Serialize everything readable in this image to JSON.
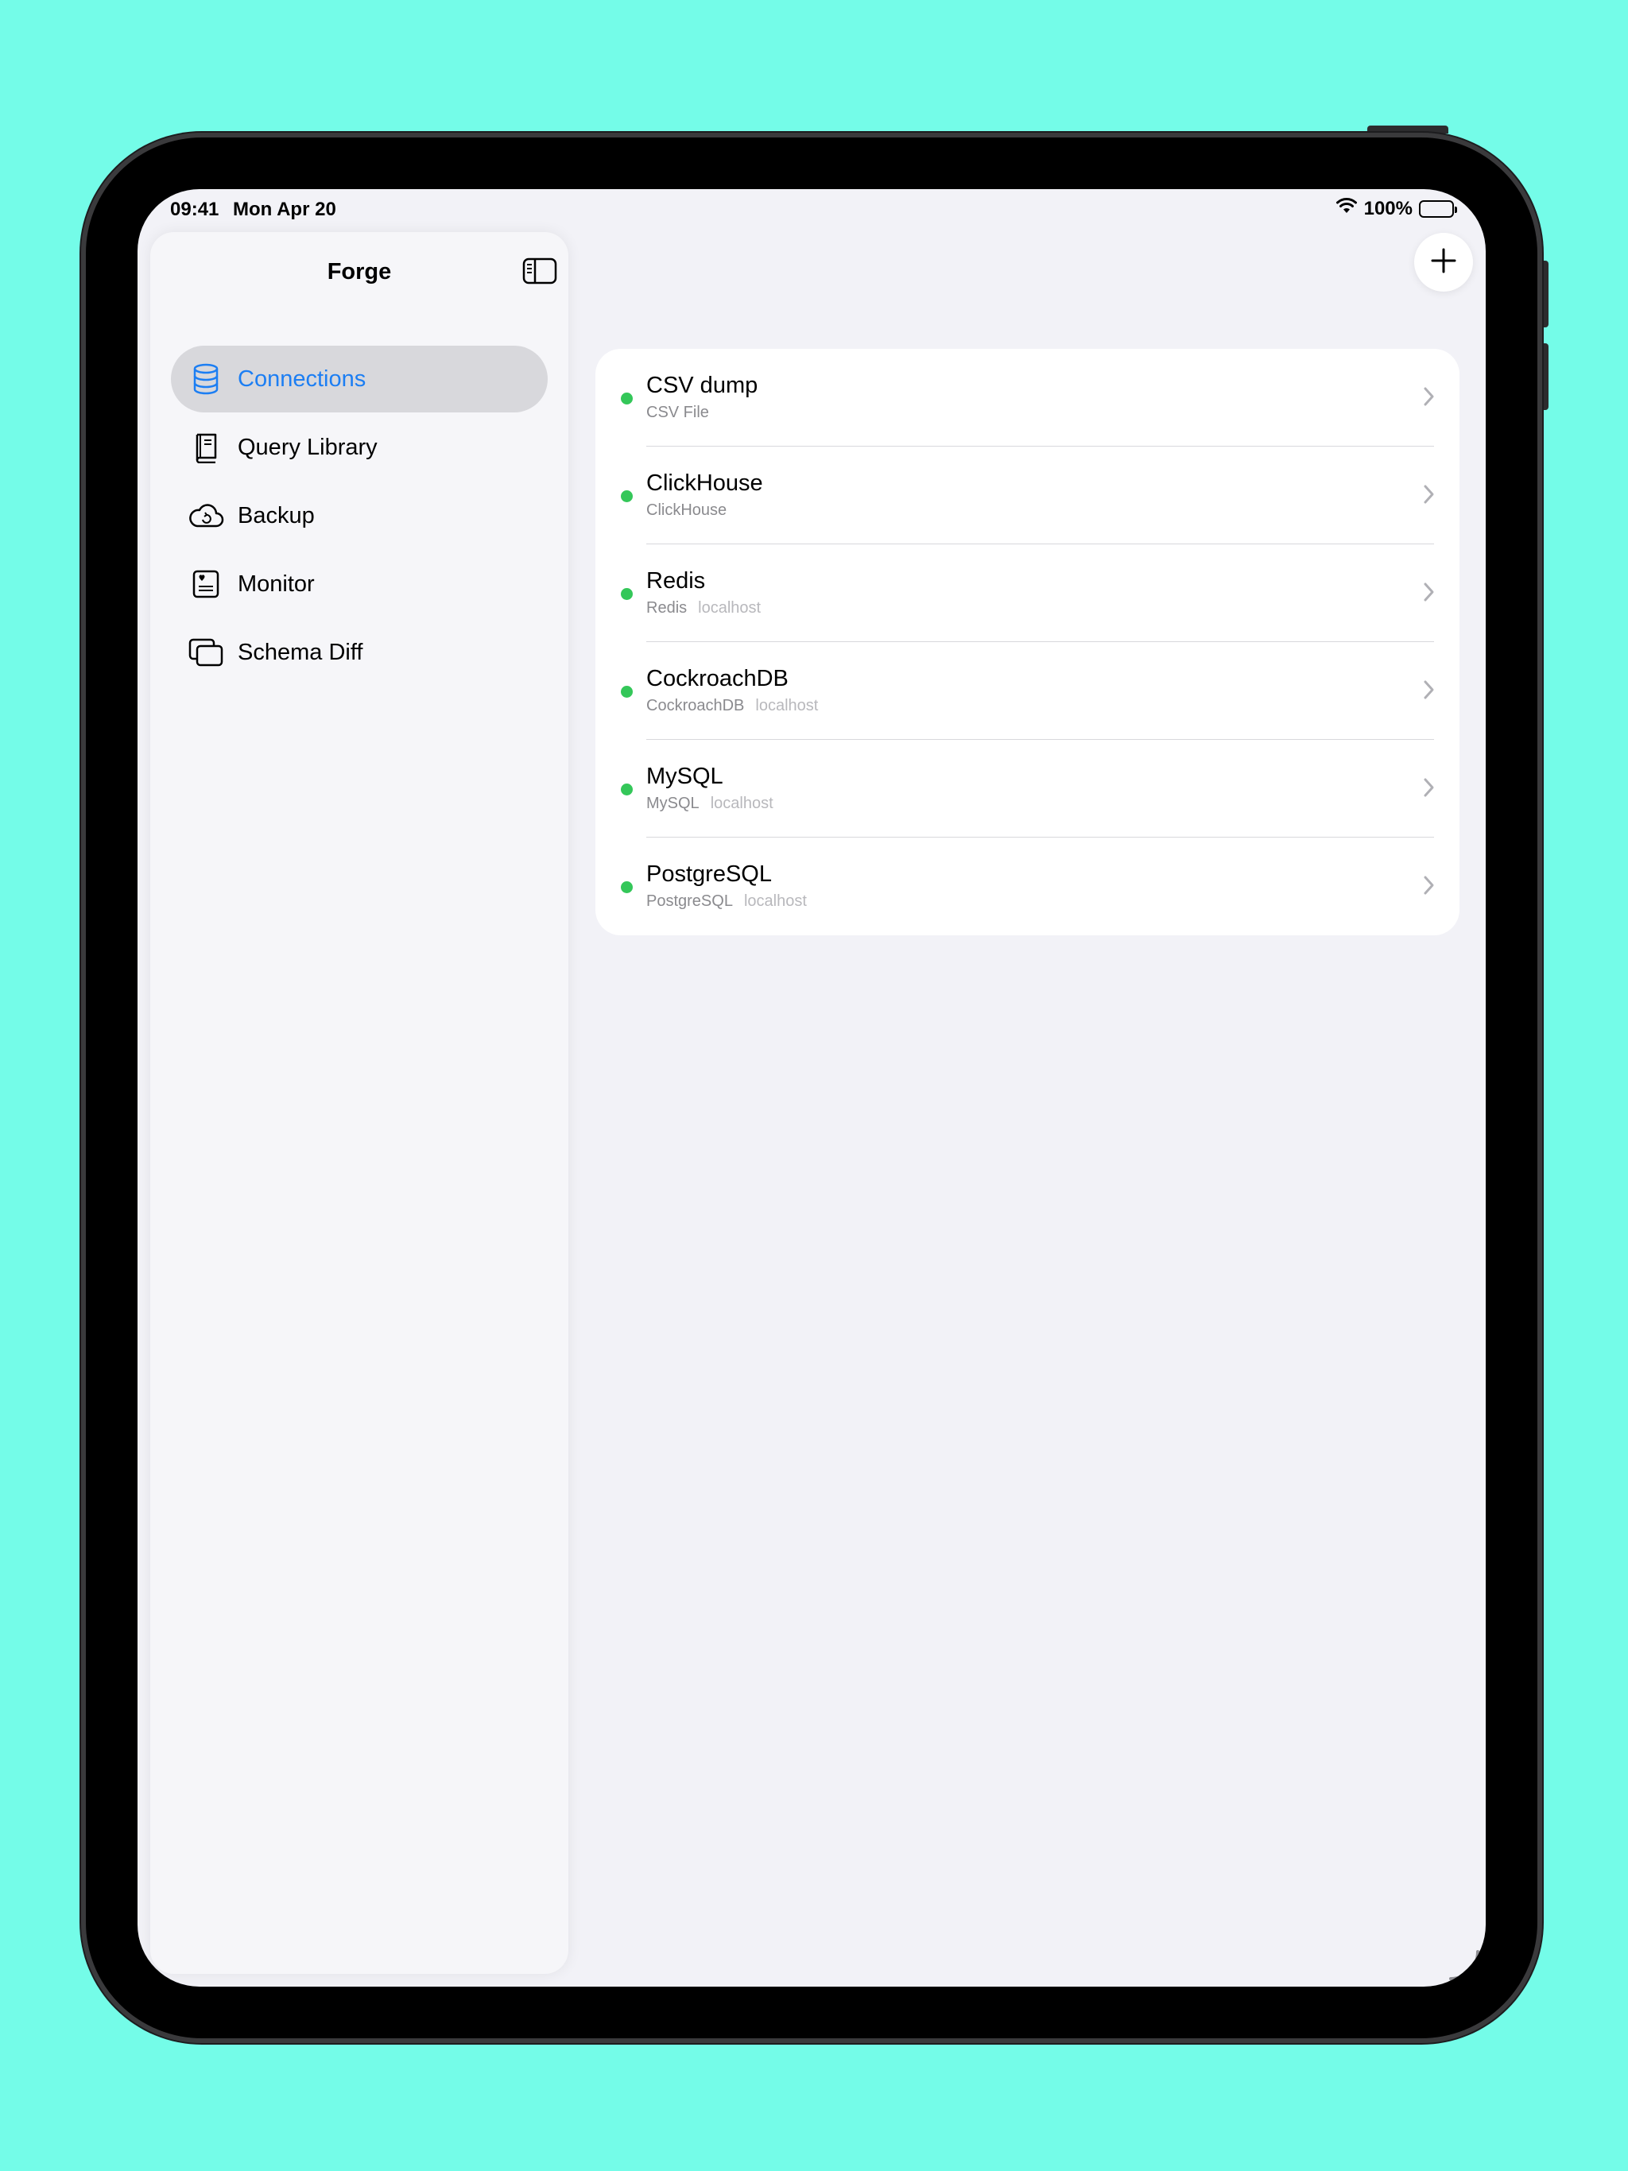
{
  "status_bar": {
    "time": "09:41",
    "date": "Mon Apr 20",
    "battery": "100%"
  },
  "sidebar": {
    "title": "Forge",
    "items": [
      {
        "label": "Connections",
        "icon": "database-icon",
        "selected": true
      },
      {
        "label": "Query Library",
        "icon": "book-icon",
        "selected": false
      },
      {
        "label": "Backup",
        "icon": "cloud-sync-icon",
        "selected": false
      },
      {
        "label": "Monitor",
        "icon": "monitor-icon",
        "selected": false
      },
      {
        "label": "Schema Diff",
        "icon": "stacked-windows-icon",
        "selected": false
      }
    ]
  },
  "connections": [
    {
      "name": "CSV dump",
      "type": "CSV File",
      "host": "",
      "status": "connected"
    },
    {
      "name": "ClickHouse",
      "type": "ClickHouse",
      "host": "",
      "status": "connected"
    },
    {
      "name": "Redis",
      "type": "Redis",
      "host": "localhost",
      "status": "connected"
    },
    {
      "name": "CockroachDB",
      "type": "CockroachDB",
      "host": "localhost",
      "status": "connected"
    },
    {
      "name": "MySQL",
      "type": "MySQL",
      "host": "localhost",
      "status": "connected"
    },
    {
      "name": "PostgreSQL",
      "type": "PostgreSQL",
      "host": "localhost",
      "status": "connected"
    }
  ],
  "colors": {
    "accent": "#1c7ef3",
    "status_connected": "#34c759",
    "background": "#74fce8"
  }
}
